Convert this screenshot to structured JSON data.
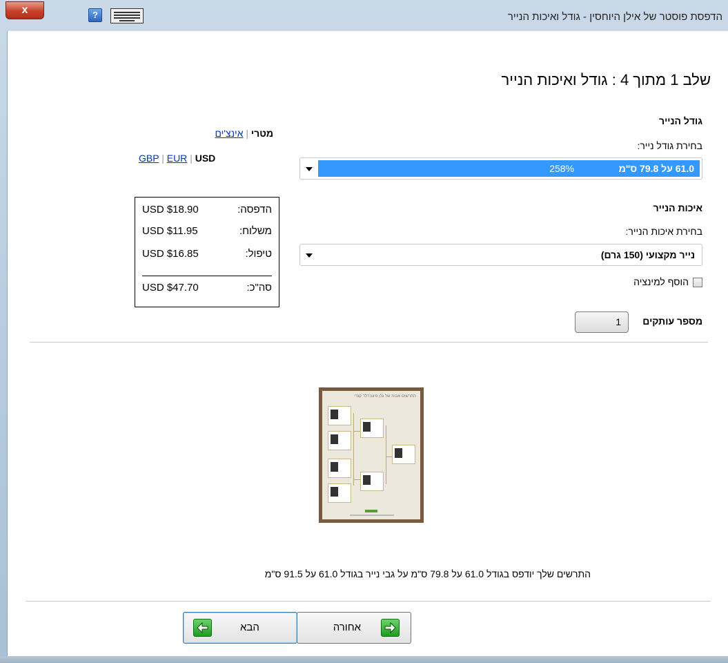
{
  "window": {
    "title": "הדפסת פוסטר של אילן היוחסין - גודל ואיכות הנייר",
    "close_label": "x",
    "help_label": "?"
  },
  "step_title": "שלב 1 מתוך 4 : גודל ואיכות הנייר",
  "paper_size": {
    "heading": "גודל הנייר",
    "select_label": "בחירת גודל נייר:",
    "selected_value": "61.0 על 79.8 ס\"מ",
    "selected_percent": "258%"
  },
  "paper_quality": {
    "heading": "איכות הנייר",
    "select_label": "בחירת איכות הנייר:",
    "selected_value": "נייר מקצועי (150 גרם)",
    "lamination_label": "הוסף למינציה",
    "lamination_checked": false
  },
  "copies": {
    "label": "מספר עותקים",
    "value": "1"
  },
  "units": {
    "metric": "מטרי",
    "separator": "|",
    "inches": "אינצ'ים"
  },
  "currency": {
    "usd": "USD",
    "eur": "EUR",
    "gbp": "GBP",
    "separator": "|"
  },
  "prices": {
    "print_label": "הדפסה:",
    "print_value": "USD $18.90",
    "shipping_label": "משלוח:",
    "shipping_value": "USD $11.95",
    "handling_label": "טיפול:",
    "handling_value": "USD $16.85",
    "total_label": "סה\"כ:",
    "total_value": "USD $47.70"
  },
  "preview": {
    "poster_title": "התרשים אבות של גלן פיצג'רלד קנדי"
  },
  "caption": "התרשים שלך יודפס בגודל 61.0 על 79.8 ס\"מ על גבי נייר בגודל 61.0 על 91.5 ס\"מ",
  "buttons": {
    "back_label": "אחורה",
    "next_label": "הבא"
  },
  "colors": {
    "selection": "#3399ff",
    "link": "#0033cc",
    "arrow_icon": "#1e9b1e"
  }
}
